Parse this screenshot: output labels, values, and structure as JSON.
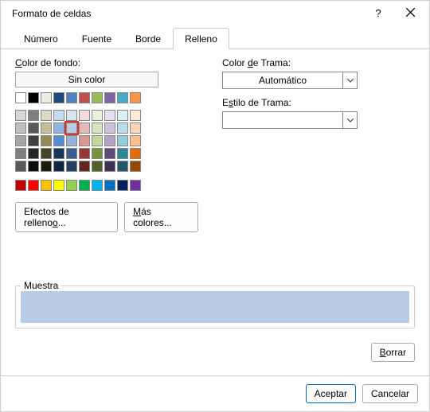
{
  "title": "Formato de celdas",
  "tabs": {
    "numero": "Número",
    "fuente": "Fuente",
    "borde": "Borde",
    "relleno": "Relleno"
  },
  "labels": {
    "color_fondo_pre": "C",
    "color_fondo_post": "olor de fondo:",
    "sin_color": "Sin color",
    "color_trama_pre": "Color ",
    "color_trama_u": "d",
    "color_trama_post": "e Trama:",
    "estilo_trama_pre": "E",
    "estilo_trama_u": "s",
    "estilo_trama_post": "tilo de Trama:",
    "automatico": "Automático",
    "efectos_pre": "Efectos de relleno",
    "efectos_u": "o",
    "efectos_post": "...",
    "mas_pre": "",
    "mas_u": "M",
    "mas_post": "ás colores...",
    "muestra": "Muestra",
    "borrar_u": "B",
    "borrar_post": "orrar",
    "aceptar": "Aceptar",
    "cancelar": "Cancelar"
  },
  "theme_row": [
    "#ffffff",
    "#000000",
    "#eeece1",
    "#1f497d",
    "#4f81bd",
    "#c0504d",
    "#9bbb59",
    "#8064a2",
    "#4bacc6",
    "#f79646"
  ],
  "palette": [
    [
      "#d8d8d8",
      "#7f7f7f",
      "#ddd9c3",
      "#c6d9f0",
      "#dbe5f1",
      "#f2dcdb",
      "#ebf1dd",
      "#e5e0ec",
      "#dbeef3",
      "#fdeada"
    ],
    [
      "#bfbfbf",
      "#595959",
      "#c4bd97",
      "#8db3e2",
      "#b8cce4",
      "#e5b9b7",
      "#d7e3bc",
      "#ccc1d9",
      "#b7dde8",
      "#fbd5b5"
    ],
    [
      "#a5a5a5",
      "#3f3f3f",
      "#938953",
      "#548dd4",
      "#95b3d7",
      "#d99694",
      "#c3d69b",
      "#b2a2c7",
      "#92cddc",
      "#fac08f"
    ],
    [
      "#7f7f7f",
      "#262626",
      "#494429",
      "#17365d",
      "#366092",
      "#953734",
      "#76923c",
      "#5f497a",
      "#31859b",
      "#e36c09"
    ],
    [
      "#595959",
      "#0c0c0c",
      "#1d1b10",
      "#0f243e",
      "#244061",
      "#632423",
      "#4f6128",
      "#3f3151",
      "#205867",
      "#974806"
    ]
  ],
  "standard": [
    "#c00000",
    "#ff0000",
    "#ffc000",
    "#ffff00",
    "#92d050",
    "#00b050",
    "#00b0f0",
    "#0070c0",
    "#002060",
    "#7030a0"
  ],
  "selected": {
    "row": 1,
    "col": 4
  },
  "sample_color": "#b8cce4"
}
